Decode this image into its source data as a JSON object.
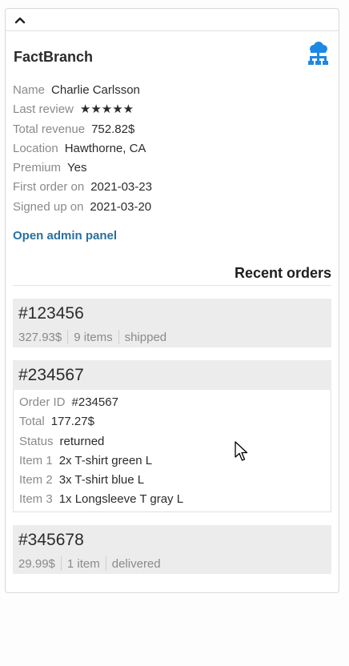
{
  "app": {
    "title": "FactBranch",
    "brand_color": "#1e88e5"
  },
  "customer": {
    "fields": [
      {
        "label": "Name",
        "value": "Charlie Carlsson"
      },
      {
        "label": "Last review",
        "value": "★★★★★"
      },
      {
        "label": "Total revenue",
        "value": "752.82$"
      },
      {
        "label": "Location",
        "value": "Hawthorne, CA"
      },
      {
        "label": "Premium",
        "value": "Yes"
      },
      {
        "label": "First order on",
        "value": "2021-03-23"
      },
      {
        "label": "Signed up on",
        "value": "2021-03-20"
      }
    ]
  },
  "admin_link": "Open admin panel",
  "recent_orders": {
    "title": "Recent orders",
    "orders": [
      {
        "id": "#123456",
        "total": "327.93$",
        "items": "9 items",
        "status": "shipped"
      },
      {
        "id": "#234567",
        "details": [
          {
            "label": "Order ID",
            "value": "#234567"
          },
          {
            "label": "Total",
            "value": "177.27$"
          },
          {
            "label": "Status",
            "value": "returned"
          },
          {
            "label": "Item 1",
            "value": "2x T-shirt green L"
          },
          {
            "label": "Item 2",
            "value": "3x T-shirt blue L"
          },
          {
            "label": "Item 3",
            "value": "1x Longsleeve T gray L"
          }
        ]
      },
      {
        "id": "#345678",
        "total": "29.99$",
        "items": "1 item",
        "status": "delivered"
      }
    ]
  }
}
